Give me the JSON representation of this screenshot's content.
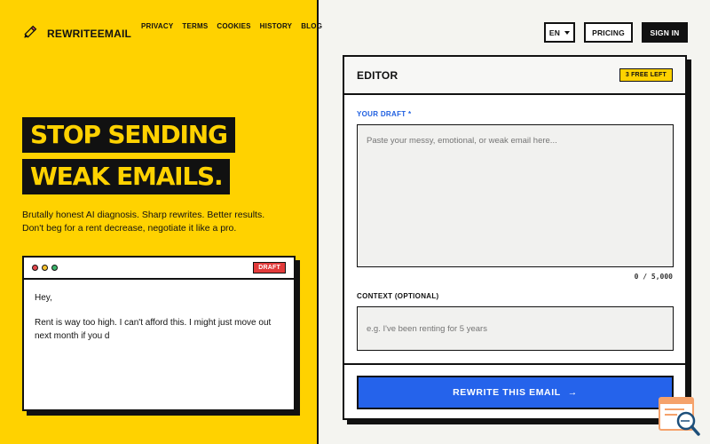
{
  "brand": {
    "name": "REWRITEEMAIL",
    "icon": "pencil-icon"
  },
  "nav": [
    "PRIVACY",
    "TERMS",
    "COOKIES",
    "HISTORY",
    "BLOG"
  ],
  "hero": {
    "line1": "STOP SENDING",
    "line2": "WEAK EMAILS.",
    "tagline1": "Brutally honest AI diagnosis. Sharp rewrites. Better results.",
    "tagline2": "Don't beg for a rent decrease, negotiate it like a pro."
  },
  "demo": {
    "badge": "DRAFT",
    "greeting": "Hey,",
    "body": "Rent is way too high. I can't afford this. I might just move out next month if you d"
  },
  "header": {
    "language": "EN",
    "pricing": "PRICING",
    "signin": "SIGN IN"
  },
  "editor": {
    "title": "EDITOR",
    "free_badge": "3 FREE LEFT",
    "draft_label": "YOUR DRAFT *",
    "draft_placeholder": "Paste your messy, emotional, or weak email here...",
    "counter": "0 / 5,000",
    "context_label": "CONTEXT (OPTIONAL)",
    "context_placeholder": "e.g. I've been renting for 5 years",
    "submit": "REWRITE THIS EMAIL",
    "submit_arrow": "→"
  },
  "colors": {
    "accent_yellow": "#ffd200",
    "primary_blue": "#2563eb",
    "badge_red": "#e23b3b"
  }
}
